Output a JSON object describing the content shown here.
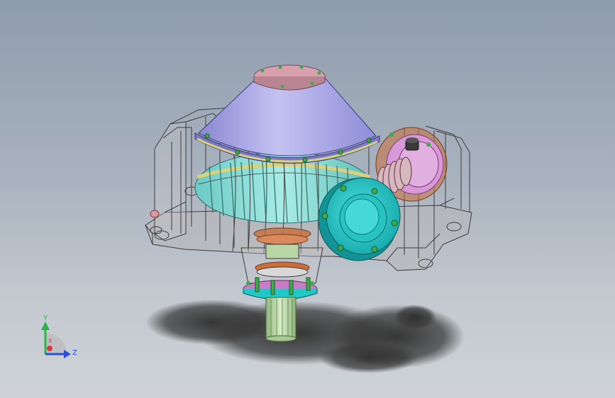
{
  "viewport": {
    "background_top": "#8f9cac",
    "background_bottom": "#cfd3d7"
  },
  "model": {
    "part_colors": {
      "housing_edges": "#3c3c3c",
      "cone_cover": "#a8a6e6",
      "top_plate": "#d8a0ae",
      "worm_wheel": "#86d7d0",
      "wheel_rim": "#d9d27a",
      "flange": "#22c7c7",
      "worm_shaft": "#d8b8c0",
      "bearing_cap": "#d998d8",
      "bolt": "#3faa4c",
      "output_shaft": "#b9d6a6",
      "bottom_ring": "#c87cc6",
      "shadow": "#3a3a3a"
    }
  },
  "triad": {
    "y_label": "Y",
    "z_label": "Z",
    "x_label": "X",
    "y_color": "#2bb54a",
    "z_color": "#2a4fd6",
    "x_color": "#d63a3a"
  }
}
